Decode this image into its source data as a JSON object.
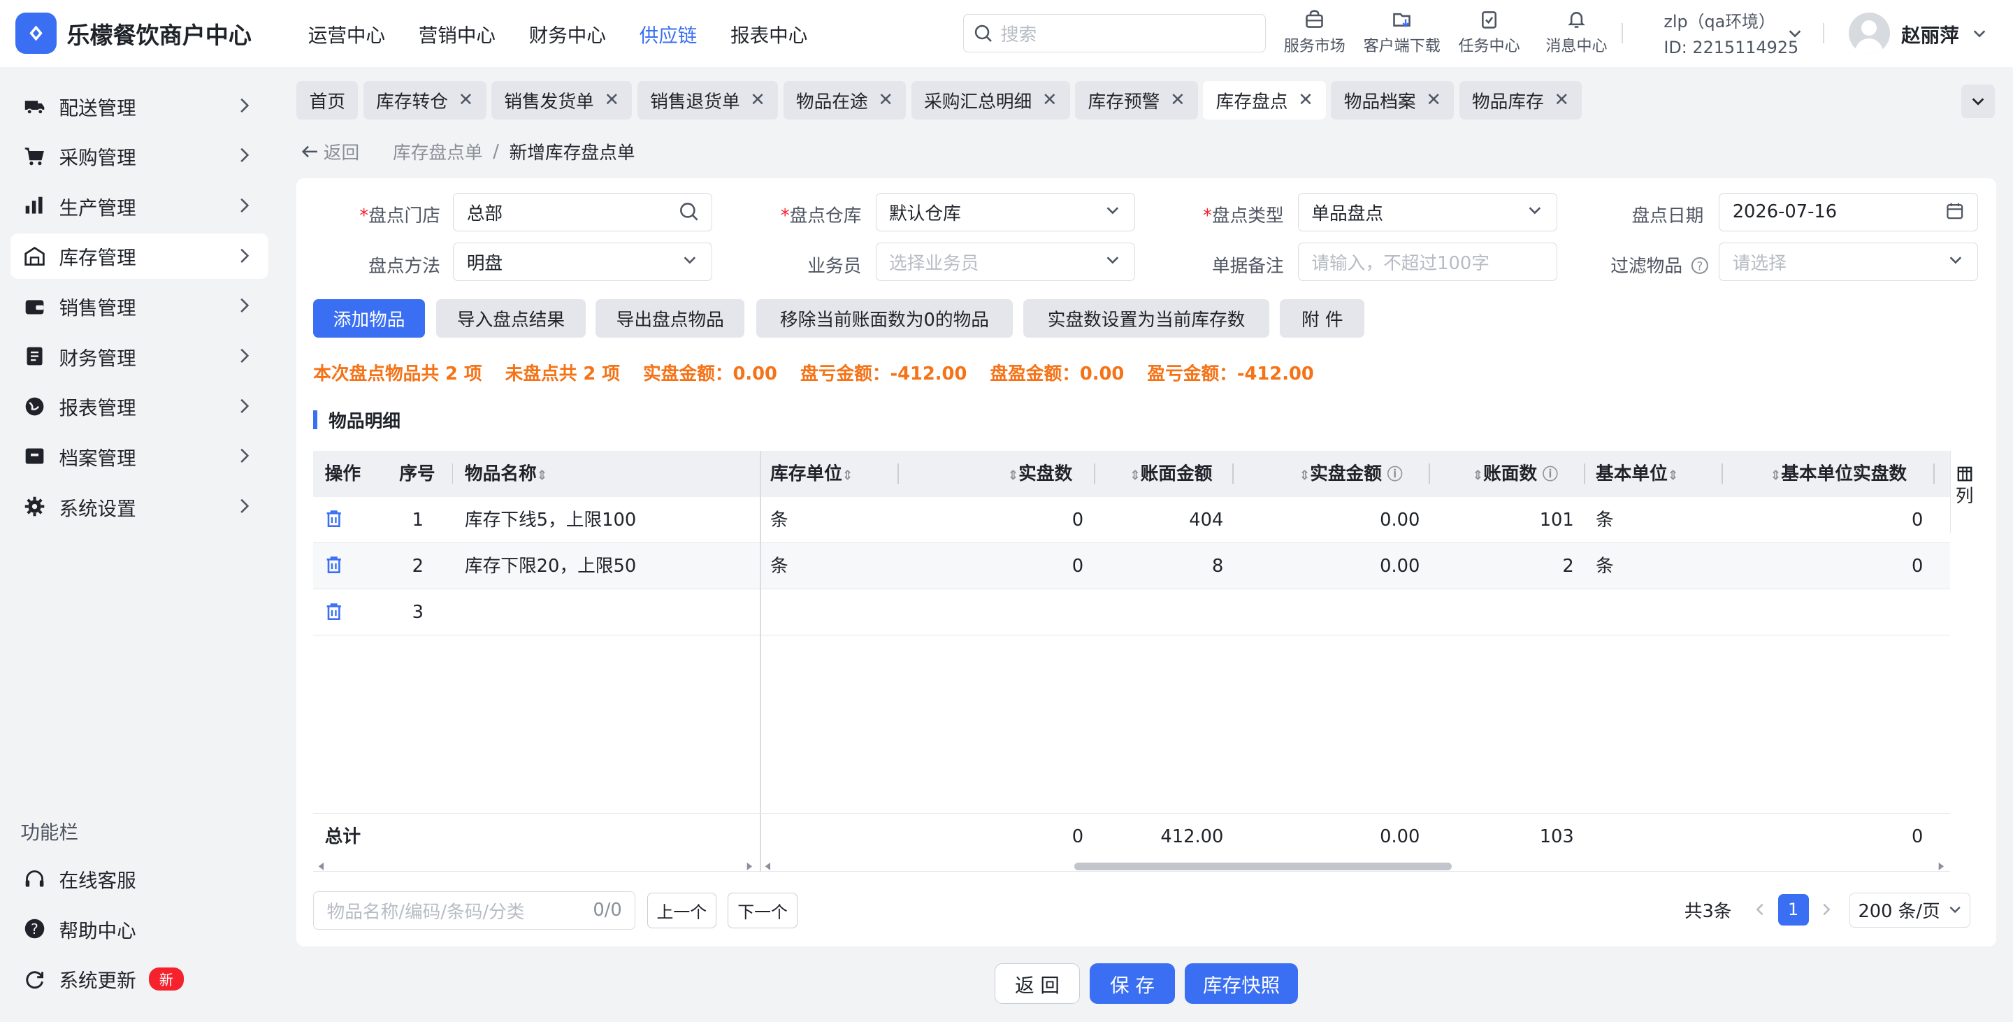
{
  "app": {
    "title": "乐檬餐饮商户中心",
    "brand_color": "#3a6ff3"
  },
  "topnav": [
    {
      "label": "运营中心",
      "active": false
    },
    {
      "label": "营销中心",
      "active": false
    },
    {
      "label": "财务中心",
      "active": false
    },
    {
      "label": "供应链",
      "active": true
    },
    {
      "label": "报表中心",
      "active": false
    }
  ],
  "search": {
    "placeholder": "搜索"
  },
  "tools": [
    {
      "label": "服务市场",
      "icon": "shop-icon"
    },
    {
      "label": "客户端下载",
      "icon": "download-icon"
    },
    {
      "label": "任务中心",
      "icon": "task-icon"
    },
    {
      "label": "消息中心",
      "icon": "bell-icon"
    }
  ],
  "env": {
    "name": "zlp（qa环境）",
    "id": "ID: 2215114925"
  },
  "user": {
    "name": "赵丽萍"
  },
  "sidebar": {
    "items": [
      {
        "label": "配送管理",
        "icon": "truck-icon",
        "active": false
      },
      {
        "label": "采购管理",
        "icon": "cart-icon",
        "active": false
      },
      {
        "label": "生产管理",
        "icon": "production-icon",
        "active": false
      },
      {
        "label": "库存管理",
        "icon": "warehouse-icon",
        "active": true
      },
      {
        "label": "销售管理",
        "icon": "wallet-icon",
        "active": false
      },
      {
        "label": "财务管理",
        "icon": "finance-icon",
        "active": false
      },
      {
        "label": "报表管理",
        "icon": "globe-icon",
        "active": false
      },
      {
        "label": "档案管理",
        "icon": "archive-icon",
        "active": false
      },
      {
        "label": "系统设置",
        "icon": "gear-icon",
        "active": false
      }
    ],
    "section_title": "功能栏",
    "bottom": [
      {
        "label": "在线客服",
        "icon": "headset-icon"
      },
      {
        "label": "帮助中心",
        "icon": "help-icon"
      },
      {
        "label": "系统更新",
        "icon": "refresh-icon",
        "badge": "新"
      }
    ]
  },
  "tabs": [
    {
      "label": "首页",
      "closable": false,
      "active": false
    },
    {
      "label": "库存转仓",
      "closable": true,
      "active": false
    },
    {
      "label": "销售发货单",
      "closable": true,
      "active": false
    },
    {
      "label": "销售退货单",
      "closable": true,
      "active": false
    },
    {
      "label": "物品在途",
      "closable": true,
      "active": false
    },
    {
      "label": "采购汇总明细",
      "closable": true,
      "active": false
    },
    {
      "label": "库存预警",
      "closable": true,
      "active": false
    },
    {
      "label": "库存盘点",
      "closable": true,
      "active": true
    },
    {
      "label": "物品档案",
      "closable": true,
      "active": false
    },
    {
      "label": "物品库存",
      "closable": true,
      "active": false
    }
  ],
  "breadcrumb": {
    "back": "返回",
    "parent": "库存盘点单",
    "sep": "/",
    "current": "新增库存盘点单"
  },
  "form": {
    "store": {
      "label": "盘点门店",
      "value": "总部"
    },
    "warehouse": {
      "label": "盘点仓库",
      "value": "默认仓库"
    },
    "type": {
      "label": "盘点类型",
      "value": "单品盘点"
    },
    "date": {
      "label": "盘点日期",
      "value": "2026-07-16"
    },
    "method": {
      "label": "盘点方法",
      "value": "明盘"
    },
    "salesman": {
      "label": "业务员",
      "placeholder": "选择业务员"
    },
    "remark": {
      "label": "单据备注",
      "placeholder": "请输入，不超过100字"
    },
    "filter": {
      "label": "过滤物品",
      "placeholder": "请选择"
    }
  },
  "actions": [
    "添加物品",
    "导入盘点结果",
    "导出盘点物品",
    "移除当前账面数为0的物品",
    "实盘数设置为当前库存数",
    "附 件"
  ],
  "summary": [
    "本次盘点物品共 2 项",
    "未盘点共 2 项",
    "实盘金额：0.00",
    "盘亏金额：-412.00",
    "盘盈金额：0.00",
    "盈亏金额：-412.00"
  ],
  "section": {
    "title": "物品明细"
  },
  "table": {
    "headers": {
      "op": "操作",
      "seq": "序号",
      "name": "物品名称",
      "unit": "库存单位",
      "real": "实盘数",
      "book_amt": "账面金额",
      "real_amt": "实盘金额",
      "book_qty": "账面数",
      "base_unit": "基本单位",
      "base_real": "基本单位实盘数"
    },
    "rows": [
      {
        "seq": "1",
        "name": "库存下线5，上限100",
        "unit": "条",
        "real": "0",
        "book_amt": "404",
        "real_amt": "0.00",
        "book_qty": "101",
        "base_unit": "条",
        "base_real": "0"
      },
      {
        "seq": "2",
        "name": "库存下限20，上限50",
        "unit": "条",
        "real": "0",
        "book_amt": "8",
        "real_amt": "0.00",
        "book_qty": "2",
        "base_unit": "条",
        "base_real": "0"
      },
      {
        "seq": "3",
        "name": "",
        "unit": "",
        "real": "",
        "book_amt": "",
        "real_amt": "",
        "book_qty": "",
        "base_unit": "",
        "base_real": ""
      }
    ],
    "total": {
      "label": "总计",
      "real": "0",
      "book_amt": "412.00",
      "real_amt": "0.00",
      "book_qty": "103",
      "base_real": "0"
    },
    "col_setting": "列"
  },
  "finder": {
    "placeholder": "物品名称/编码/条码/分类",
    "count": "0/0",
    "prev": "上一个",
    "next": "下一个"
  },
  "pager": {
    "total": "共3条",
    "page": "1",
    "size": "200 条/页"
  },
  "footer": {
    "back": "返 回",
    "save": "保 存",
    "snapshot": "库存快照"
  }
}
